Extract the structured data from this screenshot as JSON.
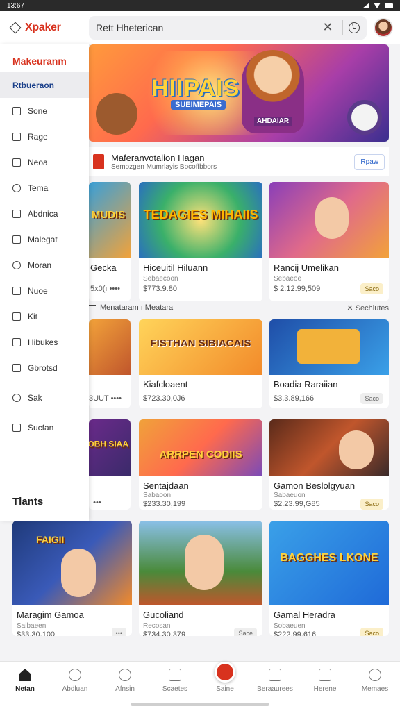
{
  "status": {
    "time": "13:67"
  },
  "header": {
    "app_name": "Xpaker",
    "search_value": "Rett Hheterican",
    "clear_symbol": "✕"
  },
  "drawer": {
    "title": "Makeuranm",
    "items": [
      {
        "label": "Rtbueraon",
        "icon": "list-icon",
        "active": true
      },
      {
        "label": "Sone",
        "icon": "link-icon"
      },
      {
        "label": "Rage",
        "icon": "image-icon"
      },
      {
        "label": "Neoa",
        "icon": "edit-icon"
      },
      {
        "label": "Tema",
        "icon": "clock-icon"
      },
      {
        "label": "Abdnica",
        "icon": "square-icon"
      },
      {
        "label": "Malegat",
        "icon": "camera-icon"
      },
      {
        "label": "Moran",
        "icon": "block-icon"
      },
      {
        "label": "Nuoe",
        "icon": "bookmark-icon"
      },
      {
        "label": "Kit",
        "icon": "doc-icon"
      },
      {
        "label": "Hibukes",
        "icon": "grid-icon"
      },
      {
        "label": "Gbrotsd",
        "icon": "calendar-icon"
      },
      {
        "label": "Sak",
        "icon": "circle-icon"
      },
      {
        "label": "Sucfan",
        "icon": "checkbox-icon"
      }
    ],
    "section_title": "Tlants"
  },
  "hero": {
    "title": "HIIPAIS",
    "subtitle": "SUEIMEPAIS",
    "badge": "AHDAIAR"
  },
  "promo": {
    "title": "Maferanvotalion Hagan",
    "subtitle": "Semozgen Mumrlayis Bocoffbbors",
    "button": "Rpaw"
  },
  "cards": [
    {
      "name": "Gecka",
      "sub": "",
      "price": "",
      "thumb": "MUDIS",
      "partial": true
    },
    {
      "name": "Hiceuitil Hiluann",
      "sub": "Sebaecoon",
      "price": "$773.9.80",
      "thumb": "TEDAGIES MIHAIIS",
      "btn": ""
    },
    {
      "name": "Rancij Umelikan",
      "sub": "Sebaeoe",
      "price": "$ 2.12.99,509",
      "thumb": "",
      "btn": "Saco"
    },
    {
      "name": "",
      "sub": "",
      "price": "",
      "thumb": "",
      "partial": true
    },
    {
      "name": "Kiafcloaent",
      "sub": "",
      "price": "$723.30,0J6",
      "thumb": "FISTHAN SIBIACAIS",
      "btn": ""
    },
    {
      "name": "Boadia Raraiian",
      "sub": "",
      "price": "$3,3.89,166",
      "thumb": "",
      "btn": "Saco"
    },
    {
      "name": "",
      "sub": "",
      "price": "",
      "thumb": "FOBH SIAA",
      "partial": true
    },
    {
      "name": "Sentajdaan",
      "sub": "Sabaoon",
      "price": "$233.30,199",
      "thumb": "ARRPEN CODIIS",
      "btn": ""
    },
    {
      "name": "Gamon Beslolgyuan",
      "sub": "Sabaeuon",
      "price": "$2.23.99,G85",
      "thumb": "",
      "btn": "Saco"
    },
    {
      "name": "Maragim Gamoa",
      "sub": "Saibaeen",
      "price": "$33.30,100",
      "thumb": "FAIGII",
      "btn": "•••"
    },
    {
      "name": "Gucoliand",
      "sub": "Recosan",
      "price": "$734.30,379",
      "thumb": "",
      "btn": "Sace"
    },
    {
      "name": "Gamal Heradra",
      "sub": "Sobaeuen",
      "price": "$222.99,616",
      "thumb": "BAGGHES LKONE",
      "btn": "Saco"
    }
  ],
  "row_label": {
    "left": "Menataram ı Meatara",
    "right": "Sechlutes"
  },
  "partial_prices": [
    "5x0(ı ••••",
    "3UUT ••••",
    "ı •••"
  ],
  "bottom_nav": [
    {
      "label": "Netan",
      "icon": "home-icon",
      "active": true
    },
    {
      "label": "Abdluan",
      "icon": "circle-icon"
    },
    {
      "label": "Afnsin",
      "icon": "search-icon"
    },
    {
      "label": "Scaetes",
      "icon": "image-icon"
    },
    {
      "label": "Saine",
      "icon": "play-icon",
      "center": true
    },
    {
      "label": "Beraaurees",
      "icon": "list-icon"
    },
    {
      "label": "Herene",
      "icon": "bag-icon"
    },
    {
      "label": "Memaes",
      "icon": "person-icon"
    }
  ],
  "colors": {
    "accent": "#d8321e",
    "link": "#2a62c9",
    "drawer_active_bg": "#ececef"
  }
}
